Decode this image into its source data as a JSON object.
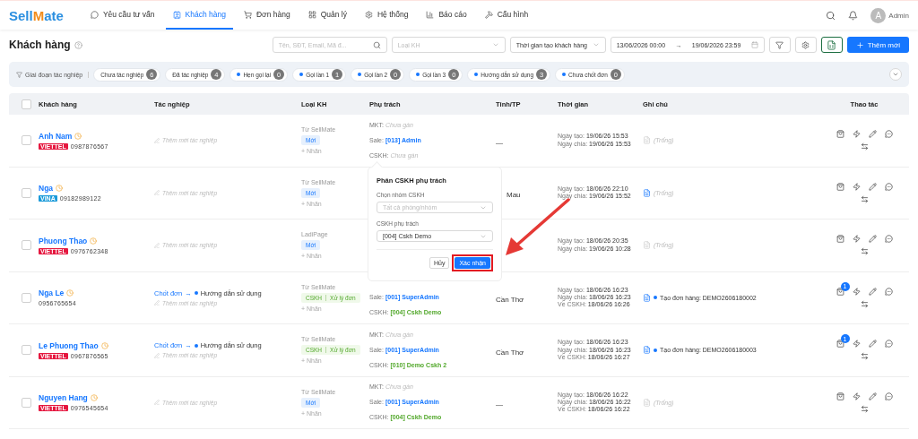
{
  "logo": [
    "Sell",
    "M",
    "ate"
  ],
  "nav": [
    {
      "label": "Yêu cầu tư vấn",
      "selected": false
    },
    {
      "label": "Khách hàng",
      "selected": true
    },
    {
      "label": "Đơn hàng",
      "selected": false
    },
    {
      "label": "Quản lý",
      "selected": false
    },
    {
      "label": "Hệ thống",
      "selected": false
    },
    {
      "label": "Báo cáo",
      "selected": false
    },
    {
      "label": "Cấu hình",
      "selected": false
    }
  ],
  "user": {
    "initial": "A",
    "name": "Admin"
  },
  "page": {
    "title": "Khách hàng"
  },
  "toolbar": {
    "search_placeholder": "Tên, SĐT, Email, Mã đ...",
    "type_placeholder": "Loại KH",
    "time_field": "Thời gian tạo khách hàng",
    "date_from": "13/06/2026 00:00",
    "date_sep": "→",
    "date_to": "19/06/2026 23:59",
    "add_label": "Thêm mới"
  },
  "stages": {
    "label": "Giai đoạn tác nghiệp",
    "chips": [
      {
        "label": "Chưa tác nghiệp",
        "count": "6",
        "dot": false
      },
      {
        "label": "Đã tác nghiệp",
        "count": "4",
        "dot": false
      },
      {
        "label": "Hẹn gọi lại",
        "count": "0",
        "dot": true
      },
      {
        "label": "Gọi lần 1",
        "count": "1",
        "dot": true
      },
      {
        "label": "Gọi lần 2",
        "count": "0",
        "dot": true
      },
      {
        "label": "Gọi lần 3",
        "count": "0",
        "dot": true
      },
      {
        "label": "Hướng dẫn sử dụng",
        "count": "3",
        "dot": true
      },
      {
        "label": "Chưa chốt đơn",
        "count": "0",
        "dot": true
      }
    ]
  },
  "select_all_checked": false,
  "columns": [
    "Khách hàng",
    "Tác nghiệp",
    "Loại KH",
    "Phụ trách",
    "Tỉnh/TP",
    "Thời gian",
    "Ghi chú",
    "Thao tác"
  ],
  "rows": [
    {
      "checked": false,
      "name": "Anh Nam",
      "carrier": {
        "label": "VIETTEL",
        "kind": "viettel"
      },
      "phone": "0987876567",
      "add_task": "Thêm mới tác nghiệp",
      "source": "Từ SellMate",
      "tags": [
        {
          "label": "Mới",
          "kind": "new"
        }
      ],
      "add_label": "+ Nhãn",
      "assignees": [
        {
          "role": "MKT:",
          "value": "Chưa gán",
          "kind": "none"
        },
        {
          "role": "Sale:",
          "value": "[013] Admin",
          "kind": "sale"
        },
        {
          "role": "CSKH:",
          "value": "Chưa gán",
          "kind": "none"
        }
      ],
      "province": "—",
      "times": [
        {
          "label": "Ngày tạo:",
          "value": "19/06/26 15:53"
        },
        {
          "label": "Ngày chia:",
          "value": "19/06/26 15:53"
        }
      ],
      "note": {
        "kind": "empty",
        "text": "(Trống)",
        "file_active": false
      }
    },
    {
      "checked": false,
      "name": "Nga",
      "carrier": {
        "label": "VINA",
        "kind": "vina"
      },
      "phone": "09182989122",
      "add_task": "Thêm mới tác nghiệp",
      "source": "Từ SellMate",
      "tags": [
        {
          "label": "Mới",
          "kind": "new"
        }
      ],
      "add_label": "+ Nhãn",
      "assignees": [],
      "province": "Mau",
      "province_partly_hidden": true,
      "times": [
        {
          "label": "Ngày tạo:",
          "value": "18/06/26 22:10"
        },
        {
          "label": "Ngày chia:",
          "value": "19/06/26 15:52"
        }
      ],
      "note": {
        "kind": "empty",
        "text": "(Trống)",
        "file_active": true
      }
    },
    {
      "checked": false,
      "name": "Phuong Thao",
      "carrier": {
        "label": "VIETTEL",
        "kind": "viettel"
      },
      "phone": "0976762348",
      "add_task": "Thêm mới tác nghiệp",
      "source": "LadiPage",
      "tags": [
        {
          "label": "Mới",
          "kind": "new"
        }
      ],
      "add_label": "+ Nhãn",
      "assignees": [],
      "times": [
        {
          "label": "Ngày tạo:",
          "value": "18/06/26 20:35"
        },
        {
          "label": "Ngày chia:",
          "value": "19/06/26 10:28"
        }
      ],
      "note": {
        "kind": "empty",
        "text": "(Trống)",
        "file_active": false
      }
    },
    {
      "checked": false,
      "name": "Nga Le",
      "phone": "0956765654",
      "flow": {
        "from": "Chốt đơn",
        "arrow": "→",
        "to": "Hướng dẫn sử dụng"
      },
      "add_task": "Thêm mới tác nghiệp",
      "source": "Từ SellMate",
      "tags": [
        {
          "label": "CSKH",
          "sub": "Xử lý đơn",
          "kind": "care"
        }
      ],
      "add_label": "+ Nhãn",
      "assignees": [
        {
          "role": "Sale:",
          "value": "[001] SuperAdmin",
          "kind": "sale"
        },
        {
          "role": "CSKH:",
          "value": "[004] Cskh Demo",
          "kind": "care"
        }
      ],
      "province": "Cần Thơ",
      "times": [
        {
          "label": "Ngày tạo:",
          "value": "18/06/26 16:23"
        },
        {
          "label": "Ngày chia:",
          "value": "18/06/26 16:23"
        },
        {
          "label": "Về CSKH:",
          "value": "18/06/26 16:26"
        }
      ],
      "note": {
        "kind": "entry",
        "text": "Tạo đơn hàng: DEMO2606180002",
        "file_active": true
      },
      "order_count": "1"
    },
    {
      "checked": false,
      "name": "Le Phuong Thao",
      "carrier": {
        "label": "VIETTEL",
        "kind": "viettel"
      },
      "phone": "0967876565",
      "flow": {
        "from": "Chốt đơn",
        "arrow": "→",
        "to": "Hướng dẫn sử dụng"
      },
      "add_task": "Thêm mới tác nghiệp",
      "source": "Từ SellMate",
      "tags": [
        {
          "label": "CSKH",
          "sub": "Xử lý đơn",
          "kind": "care"
        }
      ],
      "add_label": "+ Nhãn",
      "assignees": [
        {
          "role": "MKT:",
          "value": "Chưa gán",
          "kind": "none"
        },
        {
          "role": "Sale:",
          "value": "[001] SuperAdmin",
          "kind": "sale"
        },
        {
          "role": "CSKH:",
          "value": "[010] Demo Cskh 2",
          "kind": "care"
        }
      ],
      "province": "Cần Thơ",
      "times": [
        {
          "label": "Ngày tạo:",
          "value": "18/06/26 16:23"
        },
        {
          "label": "Ngày chia:",
          "value": "18/06/26 16:23"
        },
        {
          "label": "Về CSKH:",
          "value": "18/06/26 16:27"
        }
      ],
      "note": {
        "kind": "entry",
        "text": "Tạo đơn hàng: DEMO2606180003",
        "file_active": true
      },
      "order_count": "1"
    },
    {
      "checked": false,
      "name": "Nguyen Hang",
      "carrier": {
        "label": "VIETTEL",
        "kind": "viettel"
      },
      "phone": "0976545654",
      "add_task": "Thêm mới tác nghiệp",
      "source": "Từ SellMate",
      "tags": [
        {
          "label": "Mới",
          "kind": "new"
        }
      ],
      "add_label": "+ Nhãn",
      "assignees": [
        {
          "role": "MKT:",
          "value": "Chưa gán",
          "kind": "none"
        },
        {
          "role": "Sale:",
          "value": "[001] SuperAdmin",
          "kind": "sale"
        },
        {
          "role": "CSKH:",
          "value": "[004] Cskh Demo",
          "kind": "care"
        }
      ],
      "province": "—",
      "times": [
        {
          "label": "Ngày tạo:",
          "value": "18/06/26 16:22"
        },
        {
          "label": "Ngày chia:",
          "value": "18/06/26 16:22"
        },
        {
          "label": "Về CSKH:",
          "value": "18/06/26 16:22"
        }
      ],
      "note": {
        "kind": "empty",
        "text": "(Trống)",
        "file_active": false
      }
    }
  ],
  "popover": {
    "title": "Phân CSKH phụ trách",
    "group_label": "Chọn nhóm CSKH",
    "group_placeholder": "Tất cả phòng/nhóm",
    "staff_label": "CSKH phụ trách",
    "staff_value": "[004] Cskh Demo",
    "cancel": "Hủy",
    "confirm": "Xác nhận",
    "confirm_highlighted": true
  }
}
